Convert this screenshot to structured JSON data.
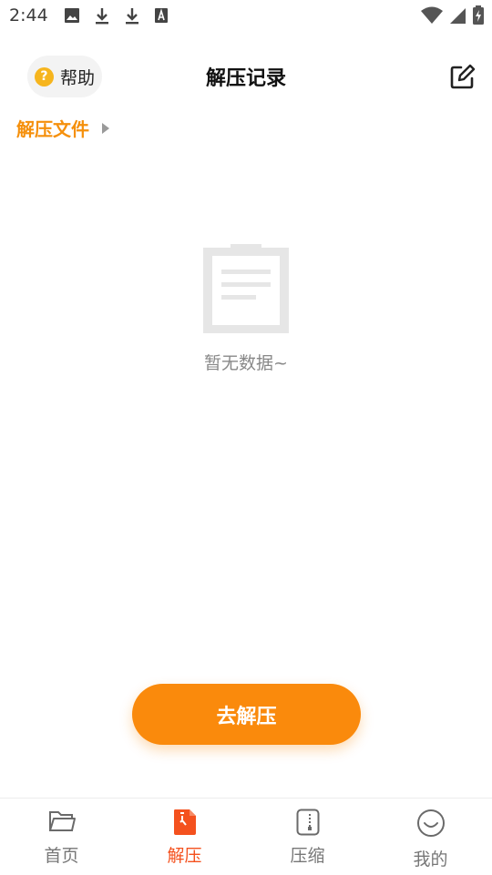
{
  "status_bar": {
    "time": "2:44",
    "left_icons": [
      "image-icon",
      "download-icon",
      "download-icon",
      "font-a-icon"
    ],
    "right_icons": [
      "wifi-icon",
      "signal-icon",
      "battery-charging-icon"
    ]
  },
  "header": {
    "help_label": "帮助",
    "help_icon": "question-circle-icon",
    "title": "解压记录",
    "edit_icon": "edit-icon"
  },
  "breadcrumb": {
    "label": "解压文件",
    "arrow_icon": "triangle-right-icon"
  },
  "empty_state": {
    "icon": "clipboard-icon",
    "text": "暂无数据~"
  },
  "action_button": {
    "label": "去解压"
  },
  "bottom_nav": {
    "items": [
      {
        "label": "首页",
        "icon": "folder-icon",
        "active": false
      },
      {
        "label": "解压",
        "icon": "zip-file-icon",
        "active": true
      },
      {
        "label": "压缩",
        "icon": "archive-icon",
        "active": false
      },
      {
        "label": "我的",
        "icon": "smile-icon",
        "active": false
      }
    ]
  },
  "colors": {
    "accent": "#fa8a0c",
    "breadcrumb": "#f5900c",
    "nav_active": "#f4511e",
    "help_icon": "#f6b51e"
  }
}
